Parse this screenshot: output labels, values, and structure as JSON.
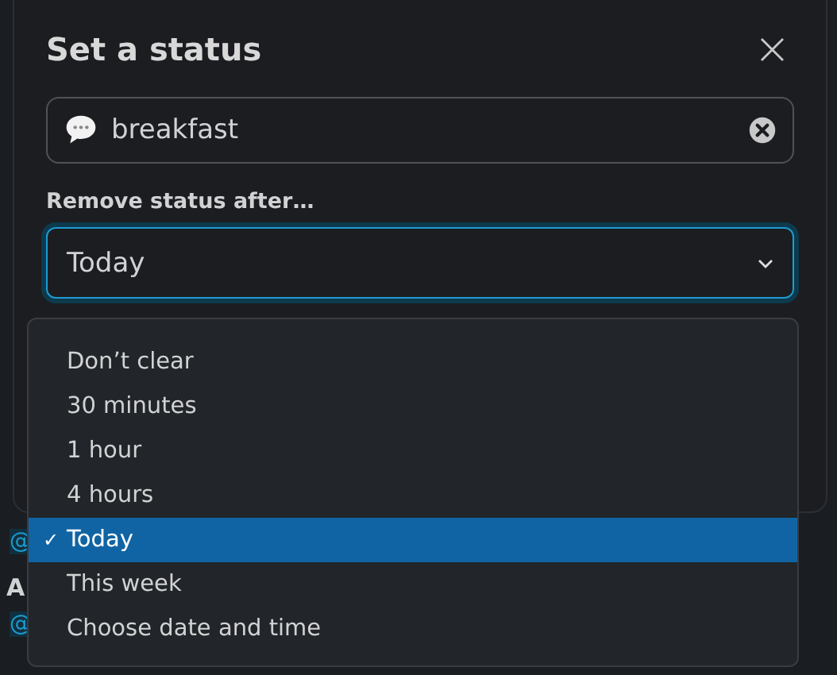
{
  "background": {
    "texts": [
      {
        "kind": "mention",
        "text": "@"
      },
      {
        "kind": "name",
        "text": "A"
      },
      {
        "kind": "mention",
        "text": "@"
      }
    ]
  },
  "dialog": {
    "title": "Set a status",
    "close": "×",
    "status_field": {
      "value": "breakfast"
    },
    "remove_label": "Remove status after…",
    "select": {
      "value": "Today",
      "expanded": true
    },
    "options": [
      {
        "label": "Don’t clear",
        "selected": false
      },
      {
        "label": "30 minutes",
        "selected": false
      },
      {
        "label": "1 hour",
        "selected": false
      },
      {
        "label": "4 hours",
        "selected": false
      },
      {
        "label": "Today",
        "selected": true
      },
      {
        "label": "This week",
        "selected": false
      },
      {
        "label": "Choose date and time",
        "selected": false
      }
    ],
    "check": "✓"
  }
}
